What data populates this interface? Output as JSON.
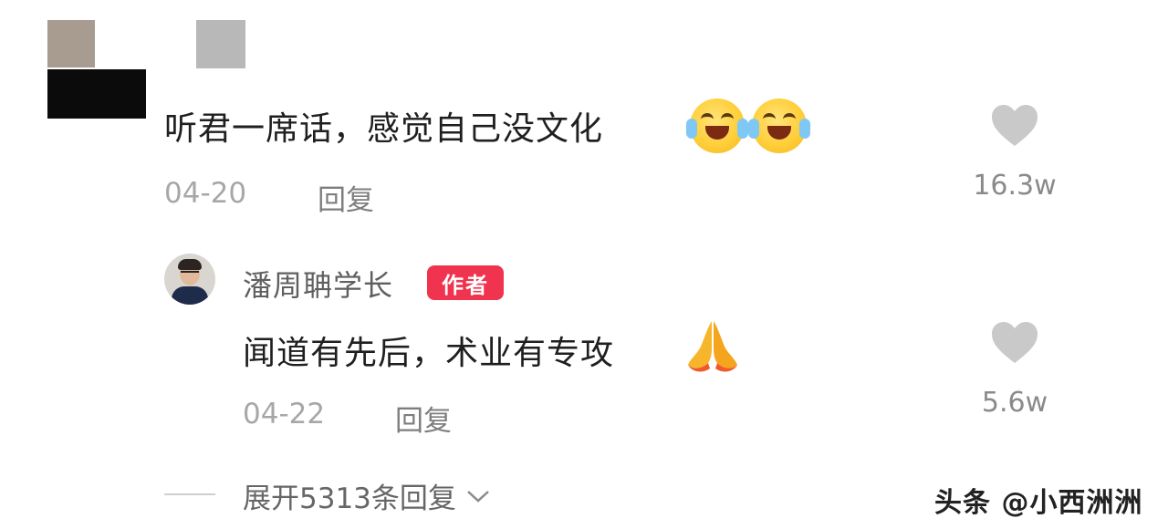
{
  "comments": [
    {
      "text": "听君一席话，感觉自己没文化",
      "date": "04-20",
      "reply_label": "回复",
      "likes": "16.3w",
      "emoji": [
        "tears-of-joy-emoji",
        "tears-of-joy-emoji"
      ]
    },
    {
      "author": "潘周聃学长",
      "author_tag": "作者",
      "text": "闻道有先后，术业有专攻",
      "date": "04-22",
      "reply_label": "回复",
      "likes": "5.6w",
      "emoji": [
        "folded-hands-emoji"
      ]
    }
  ],
  "expand_replies": "展开5313条回复",
  "watermark": "头条 @小西洲洲",
  "colors": {
    "author_tag_bg": "#f0334e",
    "like_heart": "#c9c9c9",
    "muted_text": "#a7a7a7"
  }
}
